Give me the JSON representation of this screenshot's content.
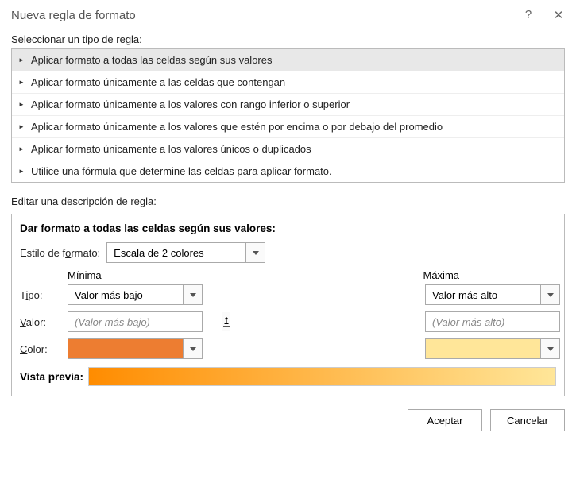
{
  "titlebar": {
    "title": "Nueva regla de formato"
  },
  "labels": {
    "select_rule_type_pre": "S",
    "select_rule_type_post": "eleccionar un tipo de regla:",
    "edit_desc": "Editar una descripción de regla:"
  },
  "rule_types": [
    "Aplicar formato a todas las celdas según sus valores",
    "Aplicar formato únicamente a las celdas que contengan",
    "Aplicar formato únicamente a los valores con rango inferior o superior",
    "Aplicar formato únicamente a los valores que estén por encima o por debajo del promedio",
    "Aplicar formato únicamente a los valores únicos o duplicados",
    "Utilice una fórmula que determine las celdas para aplicar formato."
  ],
  "desc": {
    "title": "Dar formato a todas las celdas según sus valores:",
    "format_style_label_pre": "Estilo de f",
    "format_style_label_ul": "o",
    "format_style_label_post": "rmato:",
    "format_style_value": "Escala de 2 colores",
    "min_header": "Mínima",
    "max_header": "Máxima",
    "tipo_pre": "T",
    "tipo_ul": "i",
    "tipo_post": "po:",
    "valor_ul": "V",
    "valor_post": "alor:",
    "color_ul": "C",
    "color_post": "olor:",
    "min_type": "Valor más bajo",
    "max_type": "Valor más alto",
    "min_value_placeholder": "(Valor más bajo)",
    "max_value_placeholder": "(Valor más alto)",
    "min_color": "#ed7d31",
    "max_color": "#ffe699",
    "preview_label": "Vista previa:"
  },
  "buttons": {
    "ok": "Aceptar",
    "cancel": "Cancelar"
  },
  "colors": {
    "gradient_start": "#ff8c00",
    "gradient_end": "#ffe699"
  }
}
